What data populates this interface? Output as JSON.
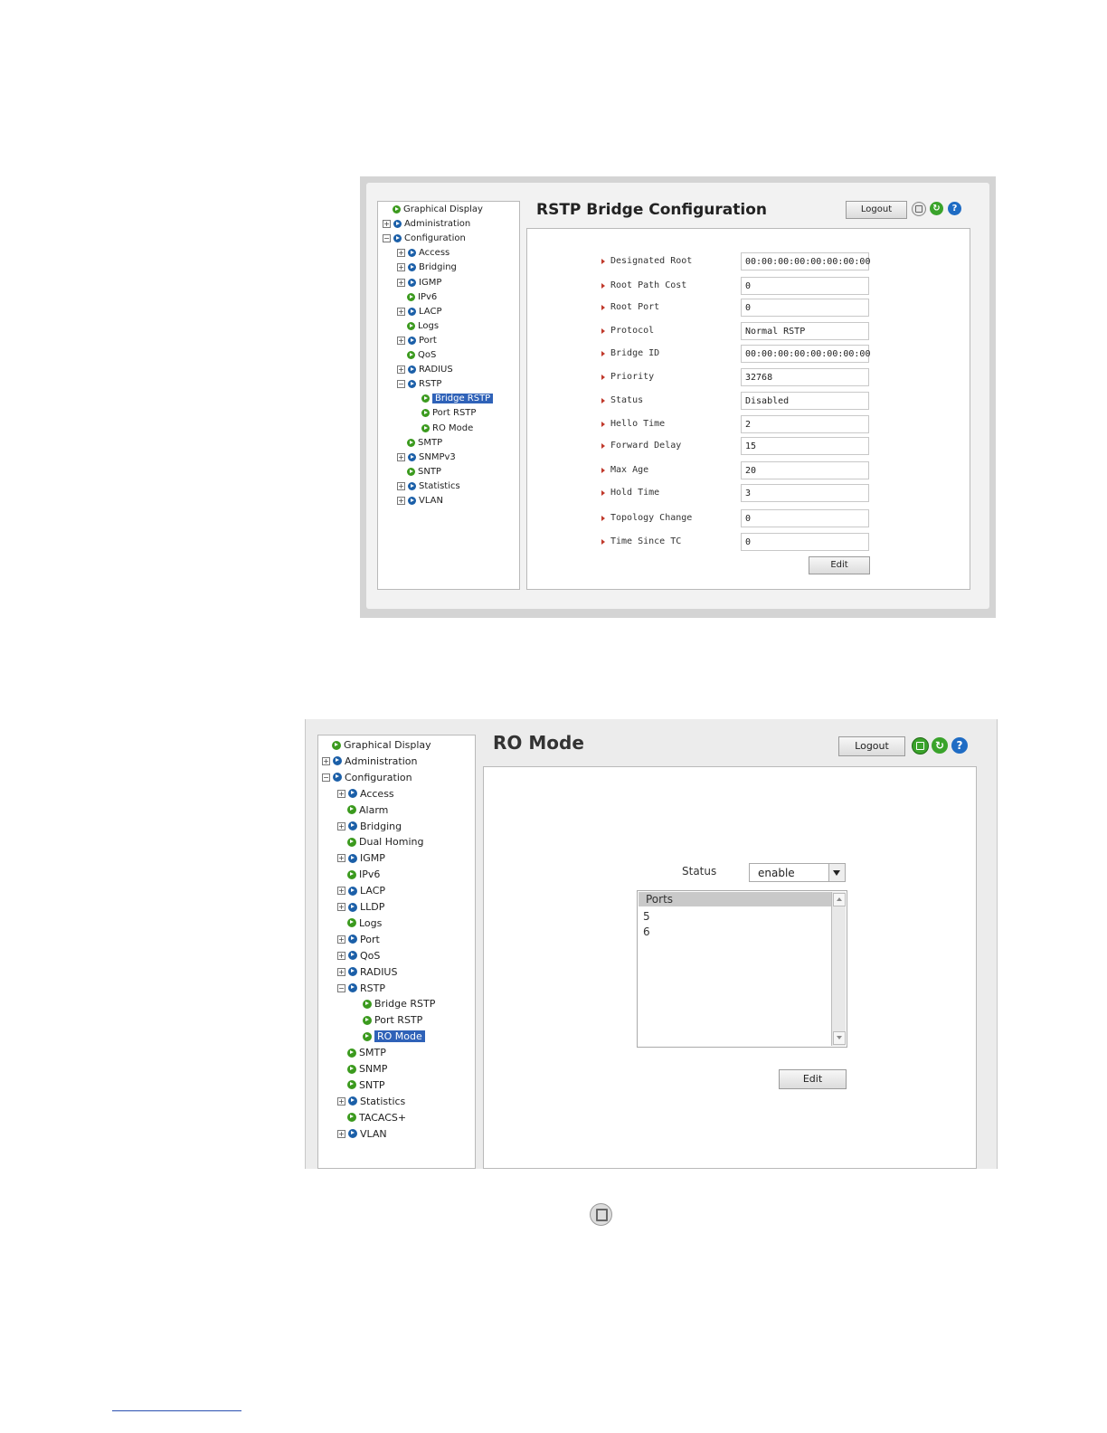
{
  "screen1": {
    "title": "RSTP Bridge Configuration",
    "logout_label": "Logout",
    "edit_label": "Edit",
    "icons": [
      "save-icon",
      "refresh-icon",
      "help-icon"
    ],
    "nav": [
      {
        "label": "Graphical Display",
        "level": 0,
        "expander": "",
        "bullet": "green"
      },
      {
        "label": "Administration",
        "level": 0,
        "expander": "+",
        "bullet": "blue"
      },
      {
        "label": "Configuration",
        "level": 0,
        "expander": "-",
        "bullet": "blue"
      },
      {
        "label": "Access",
        "level": 1,
        "expander": "+",
        "bullet": "blue"
      },
      {
        "label": "Bridging",
        "level": 1,
        "expander": "+",
        "bullet": "blue"
      },
      {
        "label": "IGMP",
        "level": 1,
        "expander": "+",
        "bullet": "blue"
      },
      {
        "label": "IPv6",
        "level": 1,
        "expander": "",
        "bullet": "green"
      },
      {
        "label": "LACP",
        "level": 1,
        "expander": "+",
        "bullet": "blue"
      },
      {
        "label": "Logs",
        "level": 1,
        "expander": "",
        "bullet": "green"
      },
      {
        "label": "Port",
        "level": 1,
        "expander": "+",
        "bullet": "blue"
      },
      {
        "label": "QoS",
        "level": 1,
        "expander": "",
        "bullet": "green"
      },
      {
        "label": "RADIUS",
        "level": 1,
        "expander": "+",
        "bullet": "blue"
      },
      {
        "label": "RSTP",
        "level": 1,
        "expander": "-",
        "bullet": "blue"
      },
      {
        "label": "Bridge RSTP",
        "level": 2,
        "expander": "",
        "bullet": "green",
        "selected": true
      },
      {
        "label": "Port RSTP",
        "level": 2,
        "expander": "",
        "bullet": "green"
      },
      {
        "label": "RO Mode",
        "level": 2,
        "expander": "",
        "bullet": "green"
      },
      {
        "label": "SMTP",
        "level": 1,
        "expander": "",
        "bullet": "green"
      },
      {
        "label": "SNMPv3",
        "level": 1,
        "expander": "+",
        "bullet": "blue"
      },
      {
        "label": "SNTP",
        "level": 1,
        "expander": "",
        "bullet": "green"
      },
      {
        "label": "Statistics",
        "level": 1,
        "expander": "+",
        "bullet": "blue"
      },
      {
        "label": "VLAN",
        "level": 1,
        "expander": "+",
        "bullet": "blue"
      }
    ],
    "fields": [
      {
        "label": "Designated Root",
        "value": "00:00:00:00:00:00:00:00"
      },
      {
        "label": "Root Path Cost",
        "value": "0"
      },
      {
        "label": "Root Port",
        "value": "0"
      },
      {
        "label": "Protocol",
        "value": "Normal RSTP"
      },
      {
        "label": "Bridge ID",
        "value": "00:00:00:00:00:00:00:00"
      },
      {
        "label": "Priority",
        "value": "32768"
      },
      {
        "label": "Status",
        "value": "Disabled"
      },
      {
        "label": "Hello Time",
        "value": "2"
      },
      {
        "label": "Forward Delay",
        "value": "15"
      },
      {
        "label": "Max Age",
        "value": "20"
      },
      {
        "label": "Hold Time",
        "value": "3"
      },
      {
        "label": "Topology Change",
        "value": "0"
      },
      {
        "label": "Time Since TC",
        "value": "0"
      }
    ]
  },
  "screen2": {
    "title": "RO Mode",
    "logout_label": "Logout",
    "edit_label": "Edit",
    "icons": [
      "save-icon",
      "refresh-icon",
      "help-icon"
    ],
    "status_label": "Status",
    "status_value": "enable",
    "ports_header": "Ports",
    "ports": [
      "5",
      "6"
    ],
    "nav": [
      {
        "label": "Graphical Display",
        "level": 0,
        "expander": "",
        "bullet": "green"
      },
      {
        "label": "Administration",
        "level": 0,
        "expander": "+",
        "bullet": "blue"
      },
      {
        "label": "Configuration",
        "level": 0,
        "expander": "-",
        "bullet": "blue"
      },
      {
        "label": "Access",
        "level": 1,
        "expander": "+",
        "bullet": "blue"
      },
      {
        "label": "Alarm",
        "level": 1,
        "expander": "",
        "bullet": "green"
      },
      {
        "label": "Bridging",
        "level": 1,
        "expander": "+",
        "bullet": "blue"
      },
      {
        "label": "Dual Homing",
        "level": 1,
        "expander": "",
        "bullet": "green"
      },
      {
        "label": "IGMP",
        "level": 1,
        "expander": "+",
        "bullet": "blue"
      },
      {
        "label": "IPv6",
        "level": 1,
        "expander": "",
        "bullet": "green"
      },
      {
        "label": "LACP",
        "level": 1,
        "expander": "+",
        "bullet": "blue"
      },
      {
        "label": "LLDP",
        "level": 1,
        "expander": "+",
        "bullet": "blue"
      },
      {
        "label": "Logs",
        "level": 1,
        "expander": "",
        "bullet": "green"
      },
      {
        "label": "Port",
        "level": 1,
        "expander": "+",
        "bullet": "blue"
      },
      {
        "label": "QoS",
        "level": 1,
        "expander": "+",
        "bullet": "blue"
      },
      {
        "label": "RADIUS",
        "level": 1,
        "expander": "+",
        "bullet": "blue"
      },
      {
        "label": "RSTP",
        "level": 1,
        "expander": "-",
        "bullet": "blue"
      },
      {
        "label": "Bridge RSTP",
        "level": 2,
        "expander": "",
        "bullet": "green"
      },
      {
        "label": "Port RSTP",
        "level": 2,
        "expander": "",
        "bullet": "green"
      },
      {
        "label": "RO Mode",
        "level": 2,
        "expander": "",
        "bullet": "green",
        "selected": true
      },
      {
        "label": "SMTP",
        "level": 1,
        "expander": "",
        "bullet": "green"
      },
      {
        "label": "SNMP",
        "level": 1,
        "expander": "",
        "bullet": "green"
      },
      {
        "label": "SNTP",
        "level": 1,
        "expander": "",
        "bullet": "green"
      },
      {
        "label": "Statistics",
        "level": 1,
        "expander": "+",
        "bullet": "blue"
      },
      {
        "label": "TACACS+",
        "level": 1,
        "expander": "",
        "bullet": "green"
      },
      {
        "label": "VLAN",
        "level": 1,
        "expander": "+",
        "bullet": "blue"
      }
    ]
  },
  "standalone_icon": "save-icon"
}
